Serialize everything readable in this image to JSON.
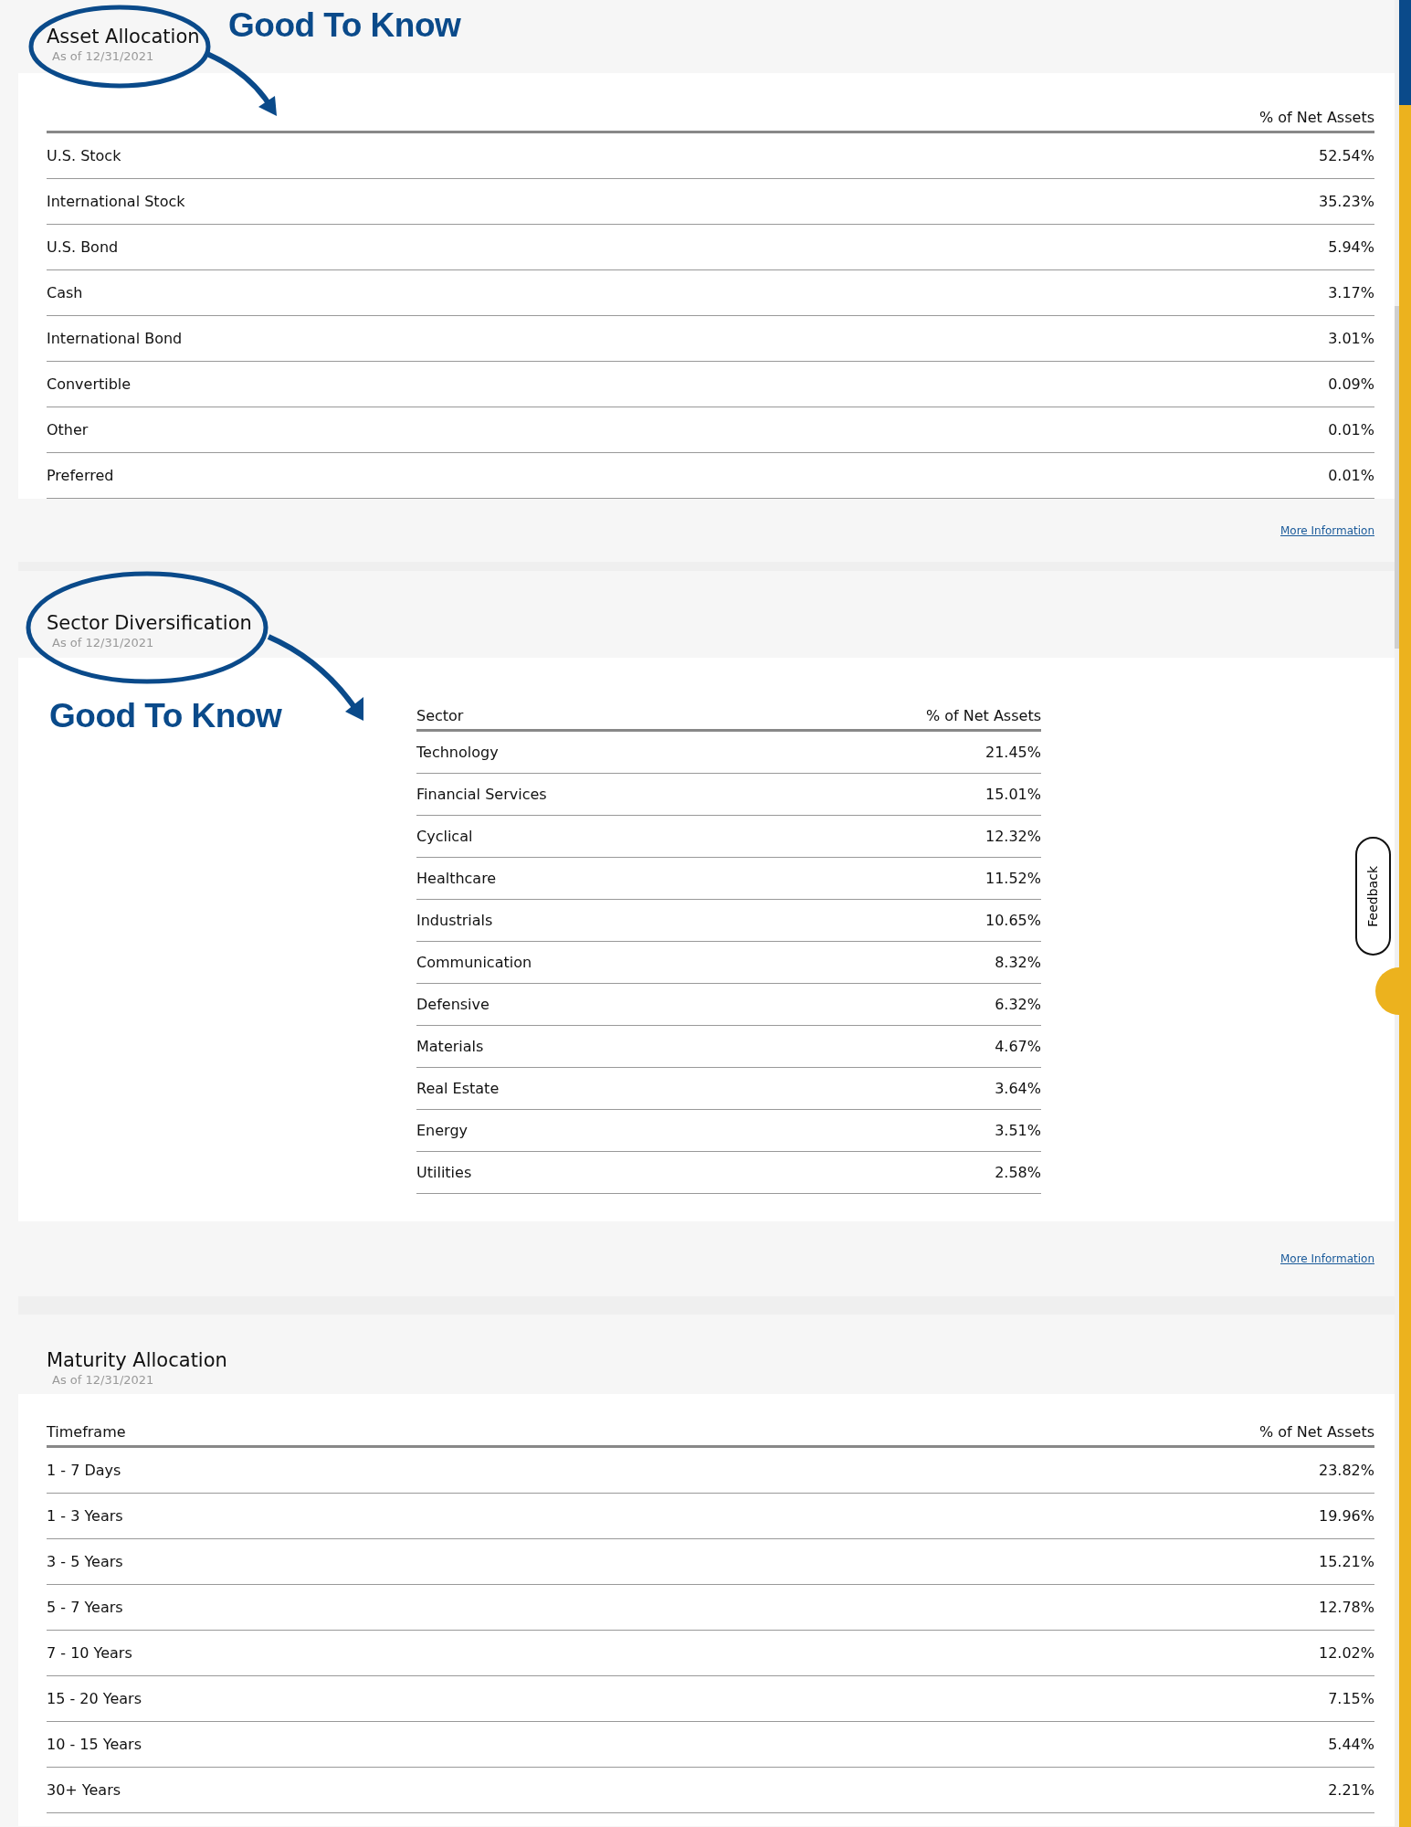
{
  "sections": [
    {
      "title": "Asset Allocation",
      "as_of": "As of 12/31/2021",
      "kind": "wide",
      "value_header": "% of Net Assets",
      "annotation": {
        "text": "Good To Know",
        "kind": "beside-title"
      },
      "rows": [
        {
          "label": "U.S. Stock",
          "value": "52.54%"
        },
        {
          "label": "International Stock",
          "value": "35.23%"
        },
        {
          "label": "U.S. Bond",
          "value": "5.94%"
        },
        {
          "label": "Cash",
          "value": "3.17%"
        },
        {
          "label": "International Bond",
          "value": "3.01%"
        },
        {
          "label": "Convertible",
          "value": "0.09%"
        },
        {
          "label": "Other",
          "value": "0.01%"
        },
        {
          "label": "Preferred",
          "value": "0.01%"
        }
      ],
      "footer_link": "More Information"
    },
    {
      "title": "Sector Diversification",
      "as_of": "As of 12/31/2021",
      "kind": "narrow",
      "label_header": "Sector",
      "value_header": "% of Net Assets",
      "annotation": {
        "text": "Good To Know",
        "kind": "below-title"
      },
      "rows": [
        {
          "label": "Technology",
          "value": "21.45%"
        },
        {
          "label": "Financial Services",
          "value": "15.01%"
        },
        {
          "label": "Cyclical",
          "value": "12.32%"
        },
        {
          "label": "Healthcare",
          "value": "11.52%"
        },
        {
          "label": "Industrials",
          "value": "10.65%"
        },
        {
          "label": "Communication",
          "value": "8.32%"
        },
        {
          "label": "Defensive",
          "value": "6.32%"
        },
        {
          "label": "Materials",
          "value": "4.67%"
        },
        {
          "label": "Real Estate",
          "value": "3.64%"
        },
        {
          "label": "Energy",
          "value": "3.51%"
        },
        {
          "label": "Utilities",
          "value": "2.58%"
        }
      ],
      "footer_link": "More Information"
    },
    {
      "title": "Maturity Allocation",
      "as_of": "As of 12/31/2021",
      "kind": "wide",
      "label_header": "Timeframe",
      "value_header": "% of Net Assets",
      "rows": [
        {
          "label": "1 - 7 Days",
          "value": "23.82%"
        },
        {
          "label": "1 - 3 Years",
          "value": "19.96%"
        },
        {
          "label": "3 - 5 Years",
          "value": "15.21%"
        },
        {
          "label": "5 - 7 Years",
          "value": "12.78%"
        },
        {
          "label": "7 - 10 Years",
          "value": "12.02%"
        },
        {
          "label": "15 - 20 Years",
          "value": "7.15%"
        },
        {
          "label": "10 - 15 Years",
          "value": "5.44%"
        },
        {
          "label": "30+ Years",
          "value": "2.21%"
        }
      ]
    }
  ],
  "feedback_tab": {
    "label": "Feedback"
  }
}
